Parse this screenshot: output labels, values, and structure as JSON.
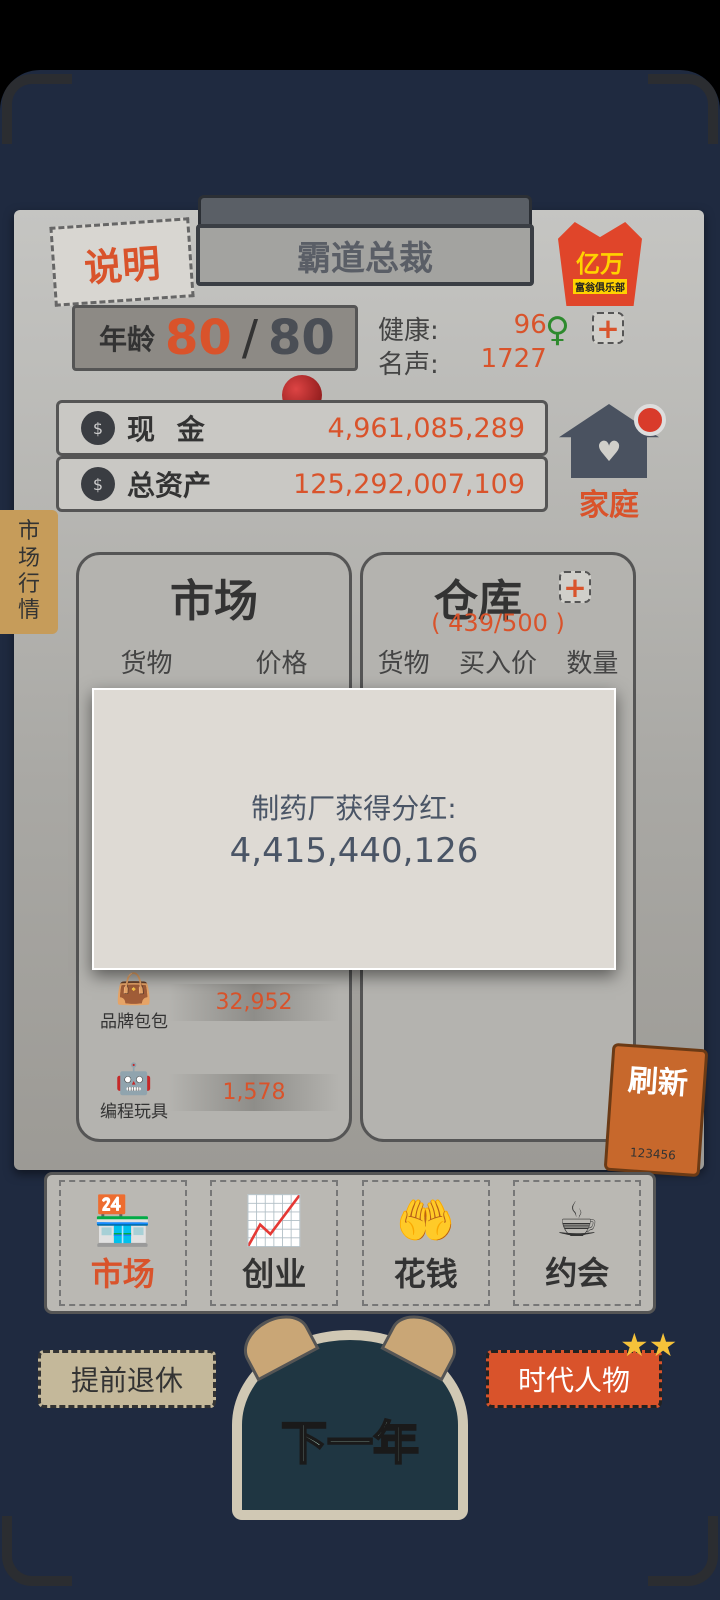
{
  "header": {
    "explain_label": "说明",
    "title": "霸道总裁",
    "badge_big": "亿万",
    "badge_small": "富翁俱乐部"
  },
  "age": {
    "label": "年龄",
    "current": "80",
    "separator": "/",
    "max": "80"
  },
  "stats": {
    "health_label": "健康:",
    "health_value": "96",
    "fame_label": "名声:",
    "fame_value": "1727",
    "plus": "+"
  },
  "money": {
    "cash_label": "现 金",
    "cash_value": "4,961,085,289",
    "assets_label": "总资产",
    "assets_value": "125,292,007,109"
  },
  "family": {
    "label": "家庭"
  },
  "side_tag": [
    "市",
    "场",
    "行",
    "情"
  ],
  "market": {
    "title": "市场",
    "col_goods": "货物",
    "col_price": "价格",
    "items": [
      {
        "name": "品牌包包",
        "price": "32,952"
      },
      {
        "name": "编程玩具",
        "price": "1,578"
      }
    ]
  },
  "warehouse": {
    "title": "仓库",
    "capacity": "( 439/500 )",
    "col_goods": "货物",
    "col_buy_price": "买入价",
    "col_qty": "数量"
  },
  "popup": {
    "message": "制药厂获得分红:",
    "amount": "4,415,440,126"
  },
  "refresh": {
    "label": "刷新",
    "number": "123456"
  },
  "nav": [
    {
      "label": "市场",
      "icon": "shop-icon",
      "active": true
    },
    {
      "label": "创业",
      "icon": "chart-icon",
      "active": false
    },
    {
      "label": "花钱",
      "icon": "hand-coin-icon",
      "active": false
    },
    {
      "label": "约会",
      "icon": "coffee-icon",
      "active": false
    }
  ],
  "bottom": {
    "retire_label": "提前退休",
    "next_year_label": "下一年",
    "era_label": "时代人物"
  },
  "colors": {
    "accent": "#d9532b",
    "board": "#1f2a40",
    "paper": "#c5c5c2"
  }
}
